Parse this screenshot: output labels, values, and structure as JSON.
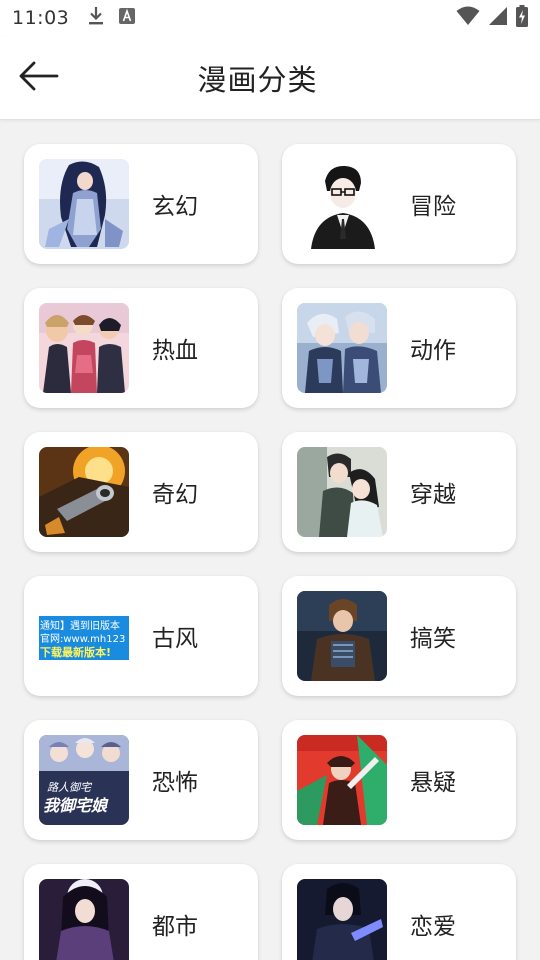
{
  "status_bar": {
    "time": "11:03",
    "icons": [
      "download-icon",
      "app-a-icon",
      "wifi-icon",
      "signal-icon",
      "battery-charging-icon"
    ]
  },
  "header": {
    "title": "漫画分类",
    "back_icon": "arrow-left-icon"
  },
  "categories": [
    {
      "label": "玄幻",
      "thumb": "fantasy-cover"
    },
    {
      "label": "冒险",
      "thumb": "adventure-cover"
    },
    {
      "label": "热血",
      "thumb": "passion-cover"
    },
    {
      "label": "动作",
      "thumb": "action-cover"
    },
    {
      "label": "奇幻",
      "thumb": "magic-cover"
    },
    {
      "label": "穿越",
      "thumb": "timetravel-cover"
    },
    {
      "label": "古风",
      "thumb": "ancient-cover",
      "thumb_text": [
        "通知】遇到旧版本",
        "官网:www.mh123",
        "下载最新版本!"
      ]
    },
    {
      "label": "搞笑",
      "thumb": "comedy-cover"
    },
    {
      "label": "恐怖",
      "thumb": "horror-cover",
      "thumb_text": [
        "路人御宅",
        "我御宅娘"
      ]
    },
    {
      "label": "悬疑",
      "thumb": "mystery-cover"
    },
    {
      "label": "都市",
      "thumb": "urban-cover"
    },
    {
      "label": "恋爱",
      "thumb": "romance-cover"
    }
  ],
  "colors": {
    "background": "#f2f2f2",
    "card": "#ffffff",
    "text": "#222222"
  }
}
